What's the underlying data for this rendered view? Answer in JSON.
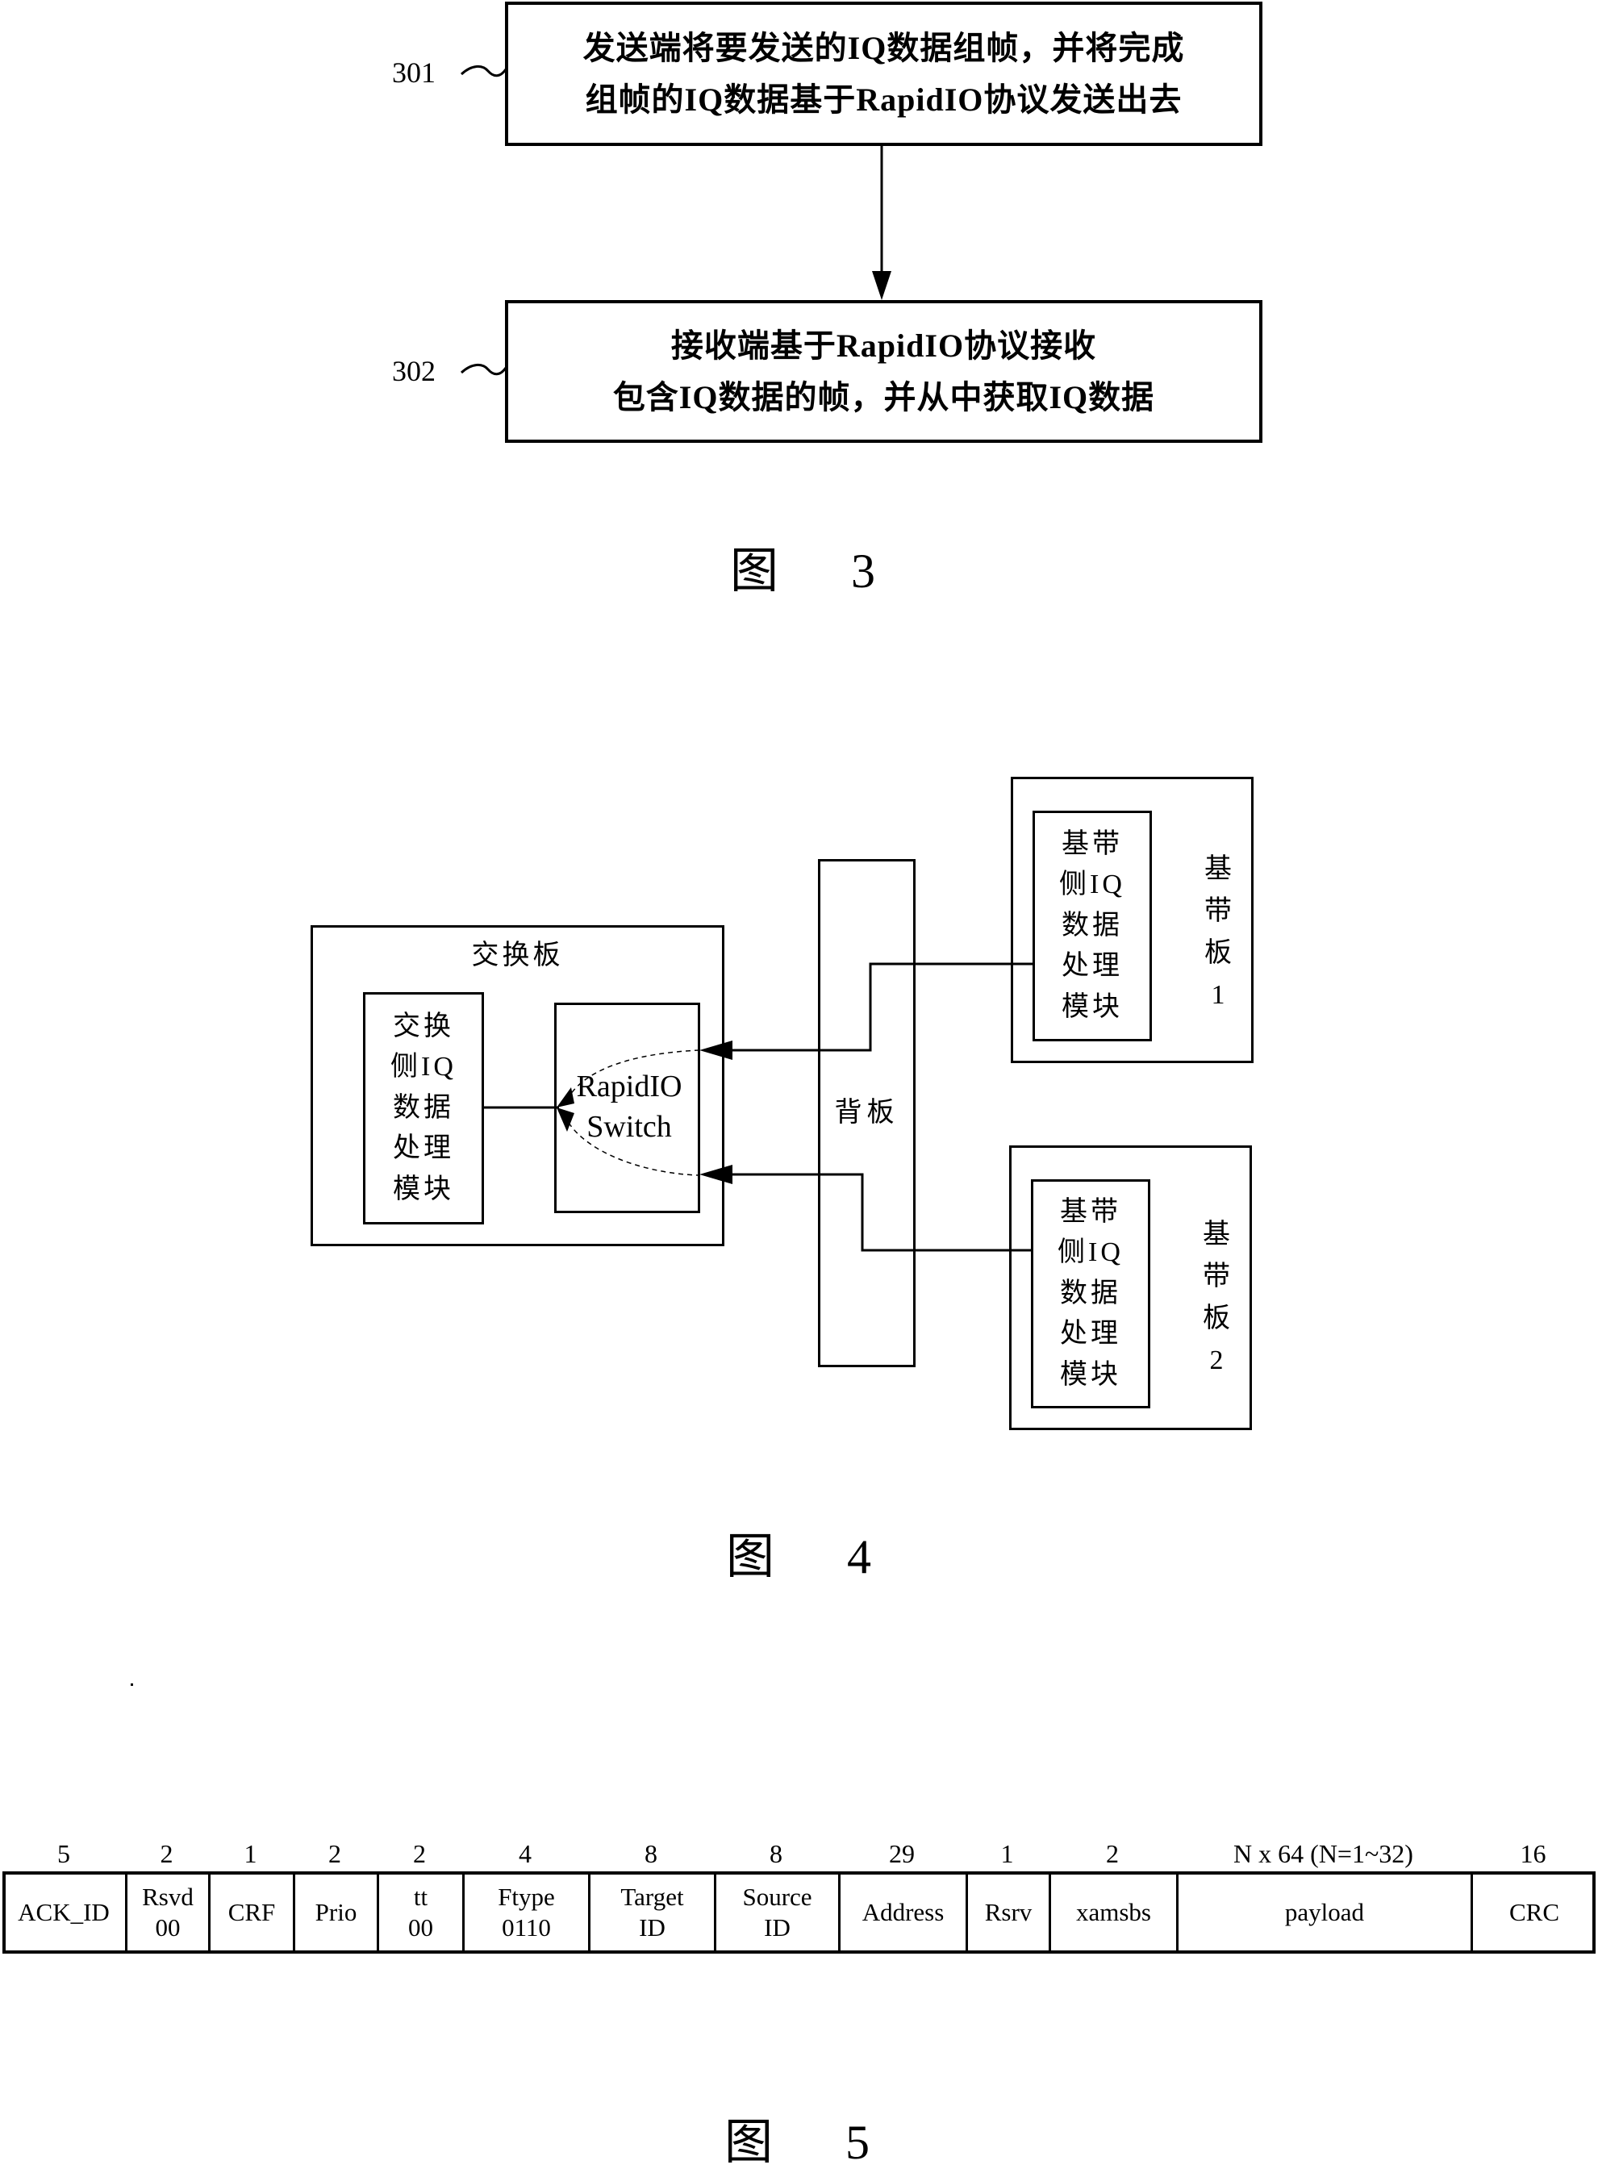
{
  "figure3": {
    "caption": {
      "prefix": "图",
      "number": "3"
    },
    "steps": [
      {
        "id": "301",
        "lines": [
          "发送端将要发送的IQ数据组帧，并将完成",
          "组帧的IQ数据基于RapidIO协议发送出去"
        ]
      },
      {
        "id": "302",
        "lines": [
          "接收端基于RapidIO协议接收",
          "包含IQ数据的帧，并从中获取IQ数据"
        ]
      }
    ],
    "tilde": "~"
  },
  "figure4": {
    "caption": {
      "prefix": "图",
      "number": "4"
    },
    "switch_board": {
      "title": "交换板",
      "module_lines": [
        "交换",
        "侧IQ",
        "数据",
        "处理",
        "模块"
      ],
      "switch_lines": [
        "RapidIO",
        "Switch"
      ]
    },
    "backplane": {
      "label": "背板"
    },
    "baseband_boards": [
      {
        "module_lines": [
          "基带",
          "侧IQ",
          "数据",
          "处理",
          "模块"
        ],
        "board_lines": [
          "基",
          "带",
          "板",
          "1"
        ]
      },
      {
        "module_lines": [
          "基带",
          "侧IQ",
          "数据",
          "处理",
          "模块"
        ],
        "board_lines": [
          "基",
          "带",
          "板",
          "2"
        ]
      }
    ]
  },
  "figure5": {
    "caption": {
      "prefix": "图",
      "number": "5"
    },
    "fields": [
      {
        "bits": "5",
        "lines": [
          "ACK_ID"
        ]
      },
      {
        "bits": "2",
        "lines": [
          "Rsvd",
          "00"
        ]
      },
      {
        "bits": "1",
        "lines": [
          "CRF"
        ]
      },
      {
        "bits": "2",
        "lines": [
          "Prio"
        ]
      },
      {
        "bits": "2",
        "lines": [
          "tt",
          "00"
        ]
      },
      {
        "bits": "4",
        "lines": [
          "Ftype",
          "0110"
        ]
      },
      {
        "bits": "8",
        "lines": [
          "Target",
          "ID"
        ]
      },
      {
        "bits": "8",
        "lines": [
          "Source",
          "ID"
        ]
      },
      {
        "bits": "29",
        "lines": [
          "Address"
        ]
      },
      {
        "bits": "1",
        "lines": [
          "Rsrv"
        ]
      },
      {
        "bits": "2",
        "lines": [
          "xamsbs"
        ]
      },
      {
        "bits": "N x 64 (N=1~32)",
        "lines": [
          "payload"
        ]
      },
      {
        "bits": "16",
        "lines": [
          "CRC"
        ]
      }
    ]
  }
}
